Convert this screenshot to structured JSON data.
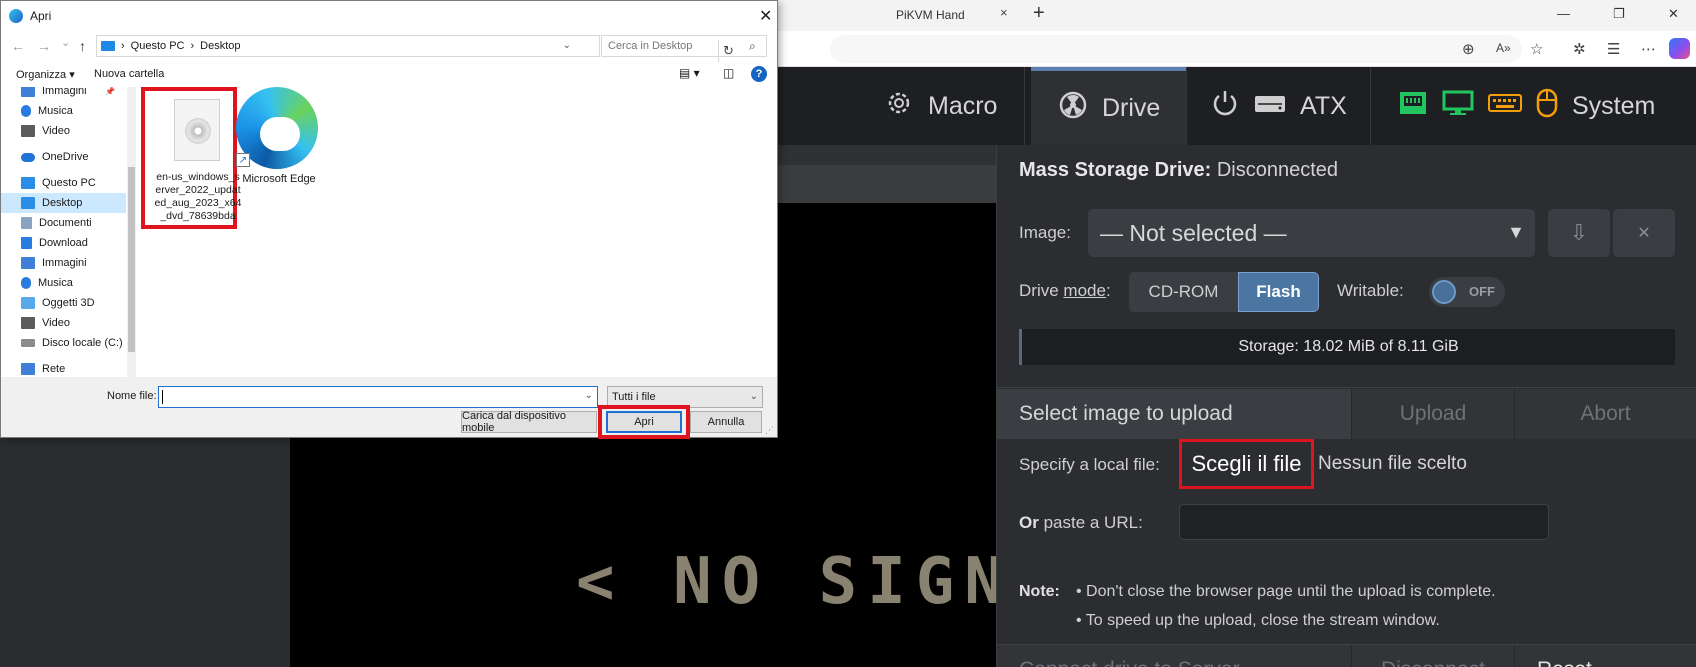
{
  "browser": {
    "tab_title": "PiKVM Hand",
    "tab_close": "×",
    "new_tab": "+",
    "window_controls": [
      "—",
      "❐",
      "✕"
    ]
  },
  "dialog": {
    "title": "Apri",
    "close": "✕",
    "nav": {
      "back": "←",
      "forward": "→",
      "down": "⌄",
      "up": "↑"
    },
    "path": [
      "Questo PC",
      "Desktop"
    ],
    "path_separator": "›",
    "search_placeholder": "Cerca in Desktop",
    "toolbar": {
      "organize": "Organizza",
      "organize_arrow": "▾",
      "new_folder": "Nuova cartella",
      "help": "?"
    },
    "sidebar": [
      {
        "label": "Immagini",
        "pinned": "📌",
        "icon": "pictures-icon",
        "color": "#3f7fd8"
      },
      {
        "label": "Musica",
        "icon": "music-icon",
        "color": "#2a7be0"
      },
      {
        "label": "Video",
        "icon": "video-icon",
        "color": "#5c5c5c"
      },
      {
        "label": "OneDrive",
        "icon": "cloud-icon",
        "color": "#1f73d6"
      },
      {
        "label": "Questo PC",
        "icon": "pc-icon",
        "color": "#2b8ee6"
      },
      {
        "label": "Desktop",
        "icon": "desktop-icon",
        "color": "#2b8ee6",
        "selected": true
      },
      {
        "label": "Documenti",
        "icon": "documents-icon",
        "color": "#8aa4c0"
      },
      {
        "label": "Download",
        "icon": "download-icon",
        "color": "#2a7be0"
      },
      {
        "label": "Immagini",
        "icon": "pictures-icon",
        "color": "#3f7fd8"
      },
      {
        "label": "Musica",
        "icon": "music-icon",
        "color": "#2a7be0"
      },
      {
        "label": "Oggetti 3D",
        "icon": "3d-objects-icon",
        "color": "#57a9e8"
      },
      {
        "label": "Video",
        "icon": "video-icon",
        "color": "#5c5c5c"
      },
      {
        "label": "Disco locale (C:)",
        "icon": "drive-icon",
        "color": "#8c8c8c"
      },
      {
        "label": "Rete",
        "icon": "network-icon",
        "color": "#3f7fd8"
      }
    ],
    "files": [
      {
        "name": "en-us_windows_server_2022_updated_aug_2023_x64_dvd_78639bda",
        "icon": "disc-image-icon"
      },
      {
        "name": "Microsoft Edge",
        "icon": "edge-icon"
      }
    ],
    "filename_label": "Nome file:",
    "filename_value": "",
    "filter": "Tutti i file",
    "buttons": {
      "mobile": "Carica dal dispositivo mobile",
      "open": "Apri",
      "cancel": "Annulla"
    }
  },
  "pikvm": {
    "nav": {
      "macro": "Macro",
      "drive": "Drive",
      "atx": "ATX",
      "system": "System"
    },
    "status_colors": {
      "network": "#22c55e",
      "display": "#22c55e",
      "keyboard": "#f59e0b",
      "mouse": "#f59e0b"
    },
    "stream": {
      "no_signal": "< NO SIGNAL"
    },
    "drive": {
      "title_bold": "Mass Storage Drive:",
      "title_status": "Disconnected",
      "image_label": "Image:",
      "image_value": "— Not selected —",
      "download_icon": "⇩",
      "remove_icon": "✕",
      "mode_label_pre": "Drive ",
      "mode_label_link": "mode",
      "mode_label_post": ":",
      "mode_cdrom": "CD-ROM",
      "mode_flash": "Flash",
      "writable_label": "Writable:",
      "writable_state": "OFF",
      "storage_text": "Storage: 18.02 MiB of 8.11 GiB",
      "tab_select": "Select image to upload",
      "tab_upload": "Upload",
      "tab_abort": "Abort",
      "local_file_label": "Specify a local file:",
      "choose_file": "Scegli il file",
      "no_file": "Nessun file scelto",
      "url_label_bold": "Or",
      "url_label": " paste a URL:",
      "note_label": "Note:",
      "notes": [
        "• Don't close the browser page until the upload is complete.",
        "• To speed up the upload, close the stream window."
      ],
      "connect": "Connect drive to Server",
      "disconnect": "Disconnect",
      "reset": "Reset"
    }
  }
}
